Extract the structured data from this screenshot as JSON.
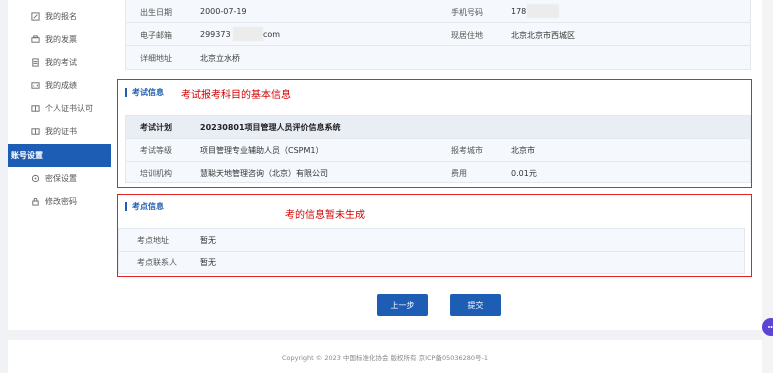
{
  "sidebar": {
    "items": [
      {
        "label": "我的报名",
        "icon": "edit-icon"
      },
      {
        "label": "我的发票",
        "icon": "printer-icon"
      },
      {
        "label": "我的考试",
        "icon": "document-icon"
      },
      {
        "label": "我的成绩",
        "icon": "chart-icon"
      },
      {
        "label": "个人证书认可",
        "icon": "certificate-icon"
      },
      {
        "label": "我的证书",
        "icon": "book-icon"
      }
    ],
    "section": "账号设置",
    "sub_items": [
      {
        "label": "密保设置",
        "icon": "shield-icon"
      },
      {
        "label": "修改密码",
        "icon": "lock-icon"
      }
    ]
  },
  "personal": {
    "birth_label": "出生日期",
    "birth_value": "2000-07-19",
    "phone_label": "手机号码",
    "phone_value": "178",
    "email_label": "电子邮箱",
    "email_value_prefix": "299373",
    "email_value_suffix": "com",
    "residence_label": "现居住地",
    "residence_value": "北京北京市西城区",
    "address_label": "详细地址",
    "address_value": "北京立水桥"
  },
  "exam_info": {
    "title": "考试信息",
    "annotation": "考试报考科目的基本信息",
    "plan_label": "考试计划",
    "plan_value": "20230801项目管理人员评价信息系统",
    "level_label": "考试等级",
    "level_value": "项目管理专业辅助人员（CSPM1）",
    "city_label": "报考城市",
    "city_value": "北京市",
    "org_label": "培训机构",
    "org_value": "慧聪天地管理咨询（北京）有限公司",
    "fee_label": "费用",
    "fee_value": "0.01元"
  },
  "site_info": {
    "title": "考点信息",
    "annotation": "考的信息暂未生成",
    "address_label": "考点地址",
    "address_value": "暂无",
    "contact_label": "考点联系人",
    "contact_value": "暂无"
  },
  "buttons": {
    "prev": "上一步",
    "submit": "提交"
  },
  "footer": {
    "text": "Copyright © 2023 中国标准化协会 版权所有 京ICP备05036280号-1"
  },
  "colors": {
    "primary": "#1e5db4",
    "annotation": "#e02424"
  }
}
